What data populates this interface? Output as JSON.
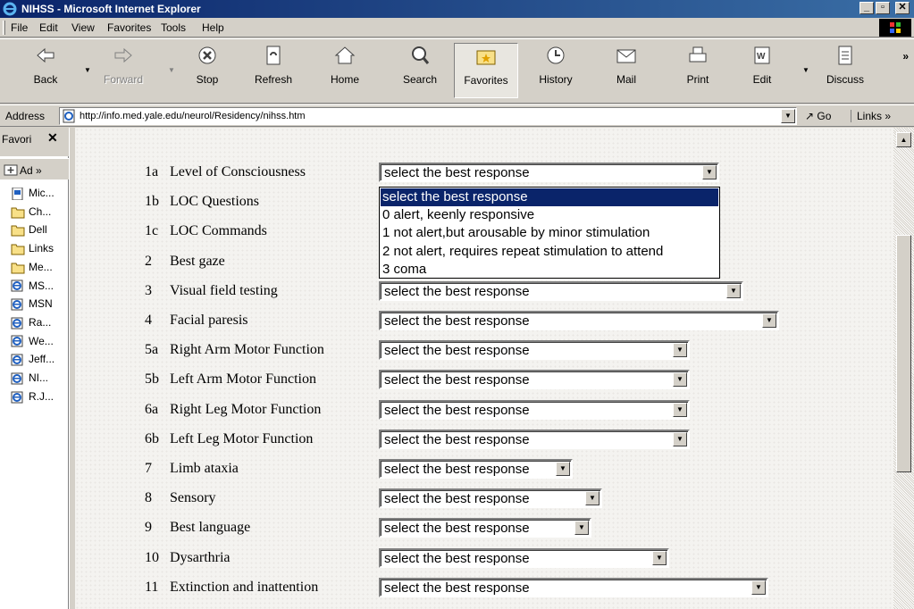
{
  "window": {
    "title": "NIHSS - Microsoft Internet Explorer",
    "controls": [
      "_",
      "▫",
      "✕"
    ]
  },
  "menu": [
    "File",
    "Edit",
    "View",
    "Favorites",
    "Tools",
    "Help"
  ],
  "toolbar": {
    "back": "Back",
    "forward": "Forward",
    "stop": "Stop",
    "refresh": "Refresh",
    "home": "Home",
    "search": "Search",
    "favorites": "Favorites",
    "history": "History",
    "mail": "Mail",
    "print": "Print",
    "edit": "Edit",
    "discuss": "Discuss",
    "more": "»"
  },
  "address": {
    "label": "Address",
    "url": "http://info.med.yale.edu/neurol/Residency/nihss.htm",
    "go": "Go",
    "links": "Links »"
  },
  "favorites_panel": {
    "title": "Favori",
    "close": "✕",
    "add": "Ad »",
    "items": [
      {
        "label": "Mic...",
        "icon": "page-icon"
      },
      {
        "label": "Ch...",
        "icon": "folder-icon"
      },
      {
        "label": "Dell",
        "icon": "folder-icon"
      },
      {
        "label": "Links",
        "icon": "folder-icon"
      },
      {
        "label": "Me...",
        "icon": "folder-icon"
      },
      {
        "label": "MS...",
        "icon": "ie-icon"
      },
      {
        "label": "MSN",
        "icon": "ie-icon"
      },
      {
        "label": "Ra...",
        "icon": "ie-icon"
      },
      {
        "label": "We...",
        "icon": "ie-icon"
      },
      {
        "label": "Jeff...",
        "icon": "ie-icon"
      },
      {
        "label": "NI...",
        "icon": "ie-icon"
      },
      {
        "label": "R.J...",
        "icon": "ie-icon"
      }
    ]
  },
  "form": {
    "placeholder": "select the best response",
    "items": [
      {
        "num": "1a",
        "label": "Level of Consciousness",
        "value": "select the best response"
      },
      {
        "num": "1b",
        "label": "LOC Questions",
        "value": ""
      },
      {
        "num": "1c",
        "label": "LOC Commands",
        "value": ""
      },
      {
        "num": "2",
        "label": "Best gaze",
        "value": ""
      },
      {
        "num": "3",
        "label": "Visual field testing",
        "value": "select the best response"
      },
      {
        "num": "4",
        "label": "Facial paresis",
        "value": "select the best response"
      },
      {
        "num": "5a",
        "label": "Right Arm Motor Function",
        "value": "select the best response"
      },
      {
        "num": "5b",
        "label": "Left Arm Motor Function",
        "value": "select the best response"
      },
      {
        "num": "6a",
        "label": "Right Leg Motor Function",
        "value": "select the best response"
      },
      {
        "num": "6b",
        "label": "Left Leg Motor Function",
        "value": "select the best response"
      },
      {
        "num": "7",
        "label": "Limb ataxia",
        "value": "select the best response"
      },
      {
        "num": "8",
        "label": "Sensory",
        "value": "select the best response"
      },
      {
        "num": "9",
        "label": "Best language",
        "value": "select the best response"
      },
      {
        "num": "10",
        "label": "Dysarthria",
        "value": "select the best response"
      },
      {
        "num": "11",
        "label": "Extinction and inattention",
        "value": "select the best response"
      }
    ],
    "open_dropdown_options": [
      "select the best response",
      "0 alert, keenly responsive",
      "1 not alert,but arousable by minor stimulation",
      "2 not alert, requires repeat stimulation to attend",
      "3 coma"
    ]
  },
  "colors": {
    "titlebar_start": "#0a246a",
    "titlebar_end": "#3a6ea5",
    "highlight": "#0a246a",
    "chrome": "#d4d0c8"
  }
}
